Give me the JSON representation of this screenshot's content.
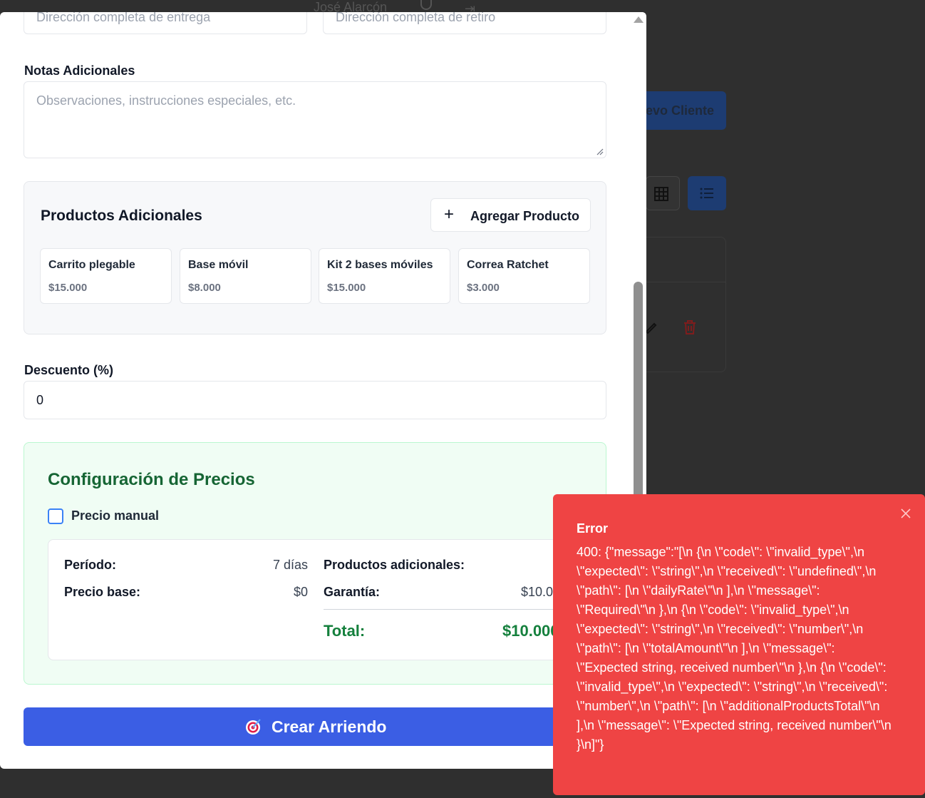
{
  "background": {
    "user_name": "José Alarcón",
    "new_client_label": "evo Cliente"
  },
  "form": {
    "delivery_address_placeholder": "Dirección completa de entrega",
    "pickup_address_placeholder": "Dirección completa de retiro",
    "notes_label": "Notas Adicionales",
    "notes_placeholder": "Observaciones, instrucciones especiales, etc.",
    "discount_label": "Descuento (%)",
    "discount_value": "0"
  },
  "products": {
    "title": "Productos Adicionales",
    "add_button_label": "Agregar Producto",
    "items": [
      {
        "name": "Carrito plegable",
        "price": "$15.000"
      },
      {
        "name": "Base móvil",
        "price": "$8.000"
      },
      {
        "name": "Kit 2 bases móviles",
        "price": "$15.000"
      },
      {
        "name": "Correa Ratchet",
        "price": "$3.000"
      }
    ]
  },
  "pricing": {
    "title": "Configuración de Precios",
    "manual_price_label": "Precio manual",
    "manual_price_checked": false,
    "period_label": "Período:",
    "period_value": "7 días",
    "base_price_label": "Precio base:",
    "base_price_value": "$0",
    "additional_products_label": "Productos adicionales:",
    "guarantee_label": "Garantía:",
    "guarantee_value": "$10.000",
    "total_label": "Total:",
    "total_value": "$10.000"
  },
  "create_button": {
    "icon": "target-icon",
    "label": "Crear Arriendo"
  },
  "toast": {
    "title": "Error",
    "message": "400: {\"message\":\"[\\n {\\n \\\"code\\\": \\\"invalid_type\\\",\\n \\\"expected\\\": \\\"string\\\",\\n \\\"received\\\": \\\"undefined\\\",\\n \\\"path\\\": [\\n \\\"dailyRate\\\"\\n ],\\n \\\"message\\\": \\\"Required\\\"\\n },\\n {\\n \\\"code\\\": \\\"invalid_type\\\",\\n \\\"expected\\\": \\\"string\\\",\\n \\\"received\\\": \\\"number\\\",\\n \\\"path\\\": [\\n \\\"totalAmount\\\"\\n ],\\n \\\"message\\\": \\\"Expected string, received number\\\"\\n },\\n {\\n \\\"code\\\": \\\"invalid_type\\\",\\n \\\"expected\\\": \\\"string\\\",\\n \\\"received\\\": \\\"number\\\",\\n \\\"path\\\": [\\n \\\"additionalProductsTotal\\\"\\n ],\\n \\\"message\\\": \\\"Expected string, received number\\\"\\n }\\n]\"}",
    "accent": "#ef4444"
  }
}
